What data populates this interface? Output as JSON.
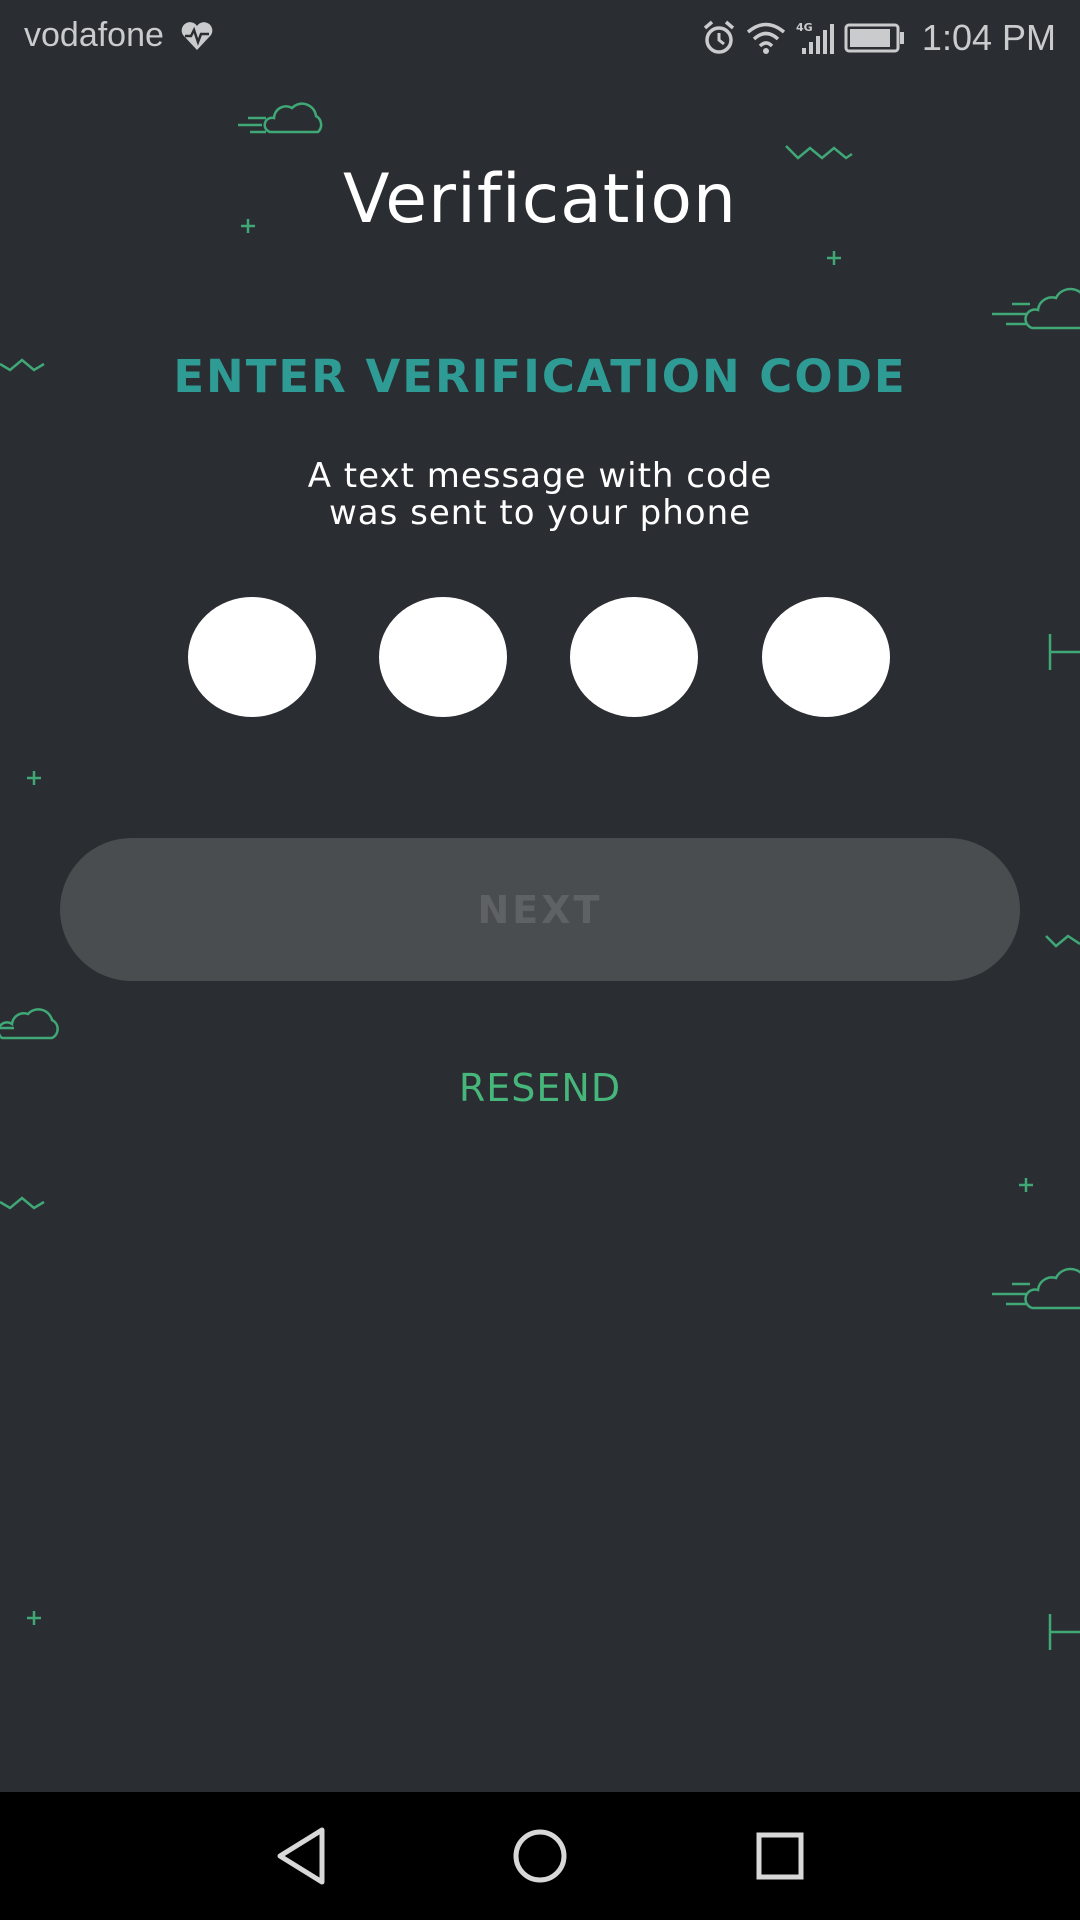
{
  "status_bar": {
    "carrier": "vodafone",
    "time": "1:04 PM",
    "network_label": "4G",
    "icons": [
      "heart-pulse-icon",
      "alarm-icon",
      "wifi-icon",
      "signal-icon",
      "battery-icon"
    ]
  },
  "screen": {
    "title": "Verification",
    "subtitle": "ENTER VERIFICATION CODE",
    "message_line1": "A text message with code",
    "message_line2": "was sent to your phone",
    "code_length": 4,
    "code_values": [
      "",
      "",
      "",
      ""
    ],
    "next_label": "NEXT",
    "next_enabled": false,
    "resend_label": "RESEND"
  },
  "nav_bar": {
    "icons": [
      "back-icon",
      "home-icon",
      "recents-icon"
    ]
  },
  "colors": {
    "background": "#2a2d32",
    "accent_teal": "#2e9c94",
    "accent_green": "#47b67a",
    "button_disabled": "#4a4d50",
    "text_primary": "#ffffff",
    "decoration": "#3fa876"
  }
}
